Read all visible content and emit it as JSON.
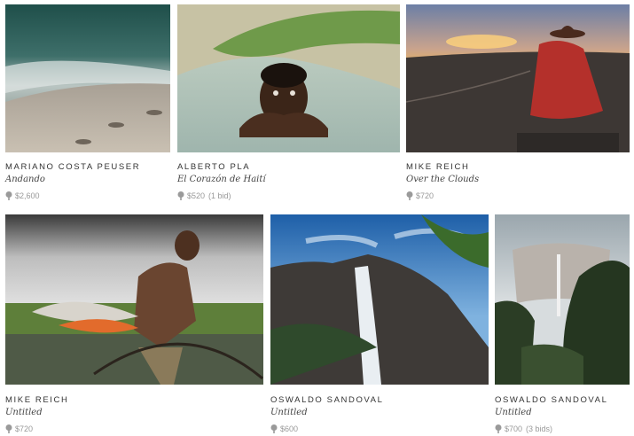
{
  "lots": [
    {
      "artist": "MARIANO COSTA PEUSER",
      "title": "Andando",
      "price": "$2,600",
      "bids": ""
    },
    {
      "artist": "ALBERTO PLA",
      "title": "El Corazón de Haití",
      "price": "$520",
      "bids": "(1 bid)"
    },
    {
      "artist": "MIKE REICH",
      "title": "Over the Clouds",
      "price": "$720",
      "bids": ""
    },
    {
      "artist": "MIKE REICH",
      "title": "Untitled",
      "price": "$720",
      "bids": ""
    },
    {
      "artist": "OSWALDO SANDOVAL",
      "title": "Untitled",
      "price": "$600",
      "bids": ""
    },
    {
      "artist": "OSWALDO SANDOVAL",
      "title": "Untitled",
      "price": "$700",
      "bids": "(3 bids)"
    }
  ],
  "icons": {
    "price": "auction-paddle-icon"
  },
  "colors": {
    "artist_text": "#333333",
    "price_text": "#999999"
  }
}
